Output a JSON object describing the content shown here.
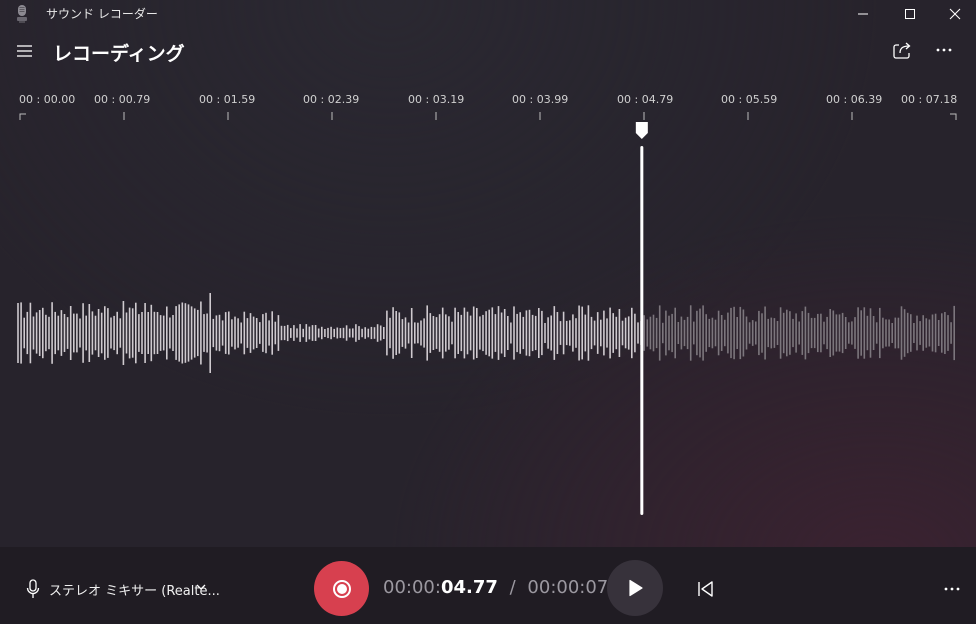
{
  "window": {
    "title": "サウンド レコーダー"
  },
  "header": {
    "title": "レコーディング"
  },
  "icons": {
    "app": "microphone-app-icon",
    "minimize": "minimize-icon",
    "maximize": "maximize-icon",
    "close": "close-icon",
    "menu": "hamburger-menu-icon",
    "share": "share-icon",
    "more": "more-icon",
    "mic": "microphone-icon",
    "chevron": "chevron-down-icon",
    "record": "record-icon",
    "play": "play-icon",
    "restart": "skip-to-start-icon"
  },
  "timeline": {
    "ticks": [
      "00 : 00.00",
      "00 : 00.79",
      "00 : 01.59",
      "00 : 02.39",
      "00 : 03.19",
      "00 : 03.99",
      "00 : 04.79",
      "00 : 05.59",
      "00 : 06.39",
      "00 : 07.18"
    ],
    "duration_seconds": 7.18,
    "playhead_seconds": 4.77
  },
  "bottom": {
    "device": "ステレオ ミキサー (Realte...",
    "time_current_prefix": "00:00:",
    "time_current_value": "04.77",
    "time_separator": "/",
    "time_total": "00:00:07"
  },
  "colors": {
    "record": "#d7404f",
    "waveform_played": "#cfcacf",
    "waveform_unplayed": "#7c767d",
    "playhead": "#ffffff"
  }
}
